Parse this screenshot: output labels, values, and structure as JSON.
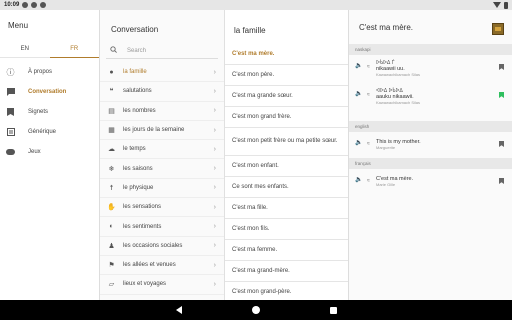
{
  "status": {
    "time": "10:09"
  },
  "menu": {
    "title": "Menu",
    "langs": [
      "EN",
      "FR"
    ],
    "items": [
      {
        "label": "À propos",
        "icon": "info-icon"
      },
      {
        "label": "Conversation",
        "icon": "chat-icon"
      },
      {
        "label": "Signets",
        "icon": "bookmark-icon"
      },
      {
        "label": "Générique",
        "icon": "credits-icon"
      },
      {
        "label": "Jeux",
        "icon": "gamepad-icon"
      }
    ]
  },
  "conversation": {
    "title": "Conversation",
    "search_placeholder": "Search",
    "categories": [
      {
        "label": "la famille",
        "icon": "person-icon"
      },
      {
        "label": "salutations",
        "icon": "speech-bubbles-icon"
      },
      {
        "label": "les nombres",
        "icon": "numbers-icon"
      },
      {
        "label": "les jours de la semaine",
        "icon": "calendar-icon"
      },
      {
        "label": "le temps",
        "icon": "cloud-icon"
      },
      {
        "label": "les saisons",
        "icon": "snowflake-icon"
      },
      {
        "label": "le physique",
        "icon": "body-icon"
      },
      {
        "label": "les sensations",
        "icon": "hand-icon"
      },
      {
        "label": "les sentiments",
        "icon": "heart-shield-icon"
      },
      {
        "label": "les occasions sociales",
        "icon": "group-icon"
      },
      {
        "label": "les allées et venues",
        "icon": "walk-icon"
      },
      {
        "label": "lieux et voyages",
        "icon": "map-icon"
      }
    ]
  },
  "phrases": {
    "title": "la famille",
    "items": [
      "C'est ma mère.",
      "C'est mon père.",
      "C'est ma grande sœur.",
      "C'est mon grand frère.",
      "C'est mon petit frère ou ma petite sœur.",
      "C'est mon enfant.",
      "Ce sont mes enfants.",
      "C'est ma fille.",
      "C'est mon fils.",
      "C'est ma femme.",
      "C'est ma grand-mère.",
      "C'est mon grand-père."
    ]
  },
  "detail": {
    "title": "C'est ma mère.",
    "sections": [
      {
        "label": "naskapi",
        "entries": [
          {
            "syllabics": "ᐅᑳᐅᐃ ᒦ",
            "text": "nikaawii uu.",
            "speaker": "Kawawachikamach Silas",
            "bookmarked": false
          },
          {
            "syllabics": "ᐊᐅᐃ ᐅᑳᐅᐃ",
            "text": "aauku nikaawii.",
            "speaker": "Kawawachikamach Silas",
            "bookmarked": true
          }
        ]
      },
      {
        "label": "english",
        "entries": [
          {
            "syllabics": "",
            "text": "This is my mother.",
            "speaker": "Marguerite",
            "bookmarked": false
          }
        ]
      },
      {
        "label": "français",
        "entries": [
          {
            "syllabics": "",
            "text": "C'est ma mère.",
            "speaker": "Marie Gille",
            "bookmarked": false
          }
        ]
      }
    ]
  },
  "colors": {
    "accent": "#b07c2c",
    "bookmark_on": "#2fbf5f"
  }
}
